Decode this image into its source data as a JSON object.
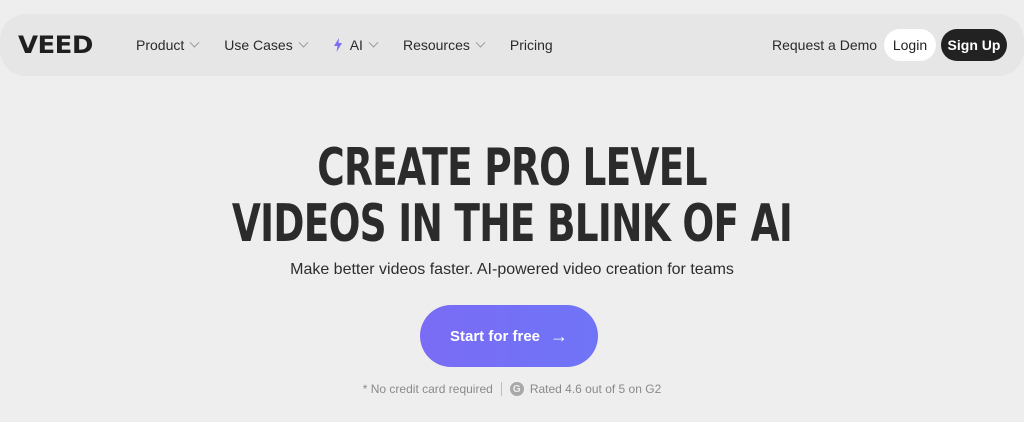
{
  "header": {
    "logo": "VEED",
    "menu": [
      {
        "label": "Product",
        "has_dropdown": true
      },
      {
        "label": "Use Cases",
        "has_dropdown": true
      },
      {
        "label": "AI",
        "has_dropdown": true,
        "icon": "lightning-icon"
      },
      {
        "label": "Resources",
        "has_dropdown": true
      },
      {
        "label": "Pricing",
        "has_dropdown": false
      }
    ],
    "request_demo": "Request a Demo",
    "login": "Login",
    "signup": "Sign Up"
  },
  "hero": {
    "headline_line1": "CREATE PRO LEVEL",
    "headline_line2": "VIDEOS IN THE BLINK OF AI",
    "subheading": "Make better videos faster. AI-powered video creation for teams",
    "cta_label": "Start for free",
    "footnote_left": "* No credit card required",
    "footnote_right": "Rated 4.6 out of 5 on G2",
    "g2_icon": "G"
  },
  "colors": {
    "background": "#eeeeee",
    "nav_bg": "#e6e6e6",
    "cta_gradient_start": "#7a6cf5",
    "cta_gradient_end": "#6f74f6",
    "ai_icon": "#7b6cf6",
    "signup_bg": "#222222"
  }
}
